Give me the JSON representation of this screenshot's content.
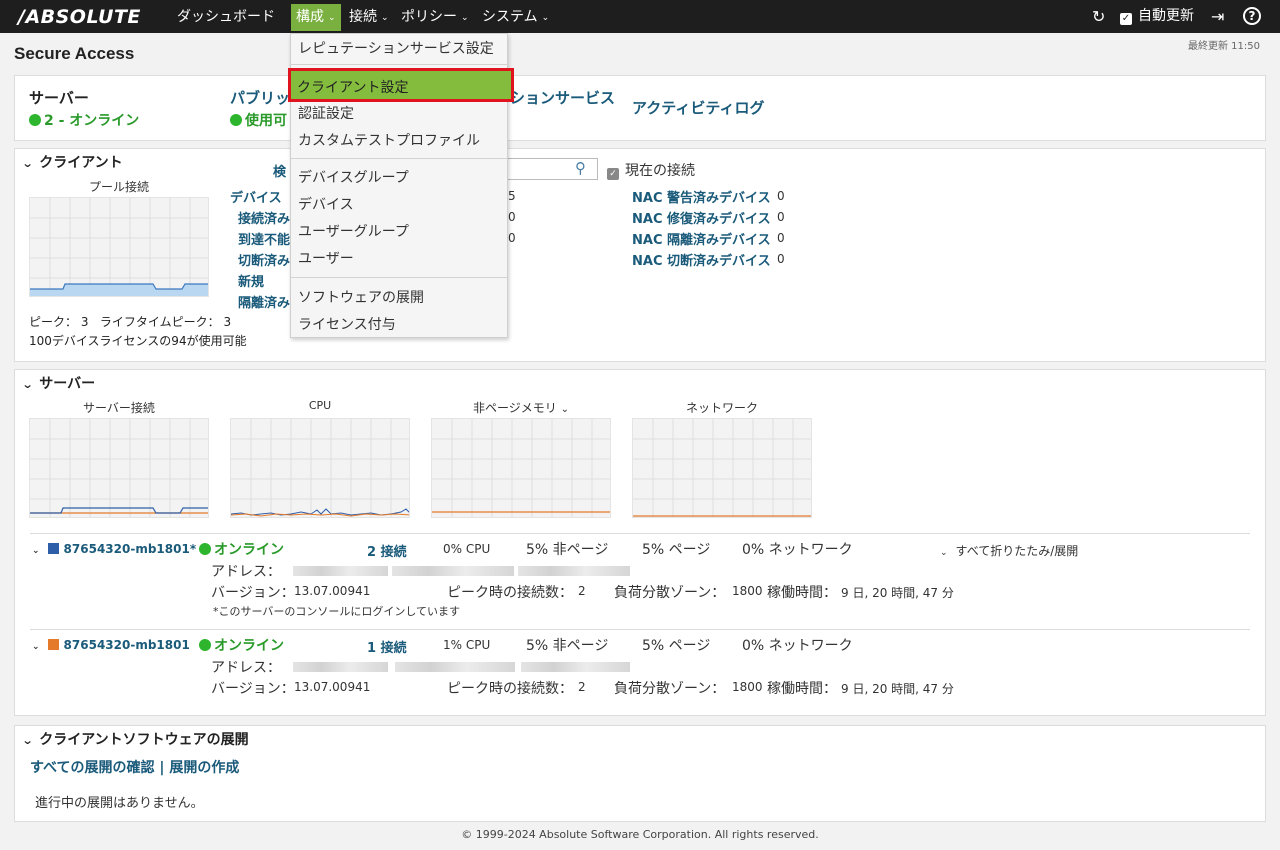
{
  "topbar": {
    "logo": "/ABSOLUTE",
    "nav": {
      "dashboard": "ダッシュボード",
      "config": "構成",
      "connect": "接続",
      "policy": "ポリシー",
      "system": "システム"
    },
    "auto_update_label": "自動更新",
    "auto_update_checked": true
  },
  "page": {
    "title": "Secure Access",
    "last_updated": "最終更新 11:50"
  },
  "summary": {
    "server_label": "サーバー",
    "server_status": "2 - オンライン",
    "public_label": "パブリック",
    "public_status": "使用可",
    "reputation_label": "ションサービス",
    "activity_log": "アクティビティログ"
  },
  "clients": {
    "section_title": "クライアント",
    "pool_title": "プール接続",
    "search_label": "検",
    "current_conn_label": "現在の接続",
    "devices_link": "デバイス",
    "device_links": [
      "接続済み",
      "到達不能",
      "切断済み",
      "新規",
      "隔離済み"
    ],
    "device_values": [
      "5",
      "0",
      "0"
    ],
    "nac": [
      {
        "label": "NAC 警告済みデバイス",
        "value": "0"
      },
      {
        "label": "NAC 修復済みデバイス",
        "value": "0"
      },
      {
        "label": "NAC 隔離済みデバイス",
        "value": "0"
      },
      {
        "label": "NAC 切断済みデバイス",
        "value": "0"
      }
    ],
    "peak_text": "ピーク： 3   ライフタイムピーク： 3",
    "license_text": "100デバイスライセンスの94が使用可能"
  },
  "servers": {
    "section_title": "サーバー",
    "chart_titles": [
      "サーバー接続",
      "CPU",
      "非ページメモリ",
      "ネットワーク"
    ],
    "collapse_all": "すべて折りたたみ/展開",
    "labels": {
      "address": "アドレス：",
      "version": "バージョン：",
      "peak": "ピーク時の接続数：",
      "zone": "負荷分散ゾーン：",
      "uptime": "稼働時間："
    },
    "rows": [
      {
        "name": "87654320-mb1801*",
        "color": "#2f5ea8",
        "status": "オンライン",
        "connections": "2 接続",
        "cpu": "0% CPU",
        "nonpage": "5% 非ページ",
        "page": "5% ページ",
        "network": "0% ネットワーク",
        "version": "13.07.00941",
        "peak": "2",
        "zone": "1800",
        "uptime": "9 日, 20 時間, 47 分",
        "note": "*このサーバーのコンソールにログインしています"
      },
      {
        "name": "87654320-mb1801",
        "color": "#e57a2a",
        "status": "オンライン",
        "connections": "1 接続",
        "cpu": "1% CPU",
        "nonpage": "5% 非ページ",
        "page": "5% ページ",
        "network": "0% ネットワーク",
        "version": "13.07.00941",
        "peak": "2",
        "zone": "1800",
        "uptime": "9 日, 20 時間, 47 分",
        "note": ""
      }
    ]
  },
  "deploy": {
    "section_title": "クライアントソフトウェアの展開",
    "view_all": "すべての展開の確認",
    "create": "展開の作成",
    "empty": "進行中の展開はありません。"
  },
  "dropdown": {
    "items": [
      "レピュテーションサービス設定",
      "クライアント設定",
      "認証設定",
      "カスタムテストプロファイル",
      "デバイスグループ",
      "デバイス",
      "ユーザーグループ",
      "ユーザー",
      "ソフトウェアの展開",
      "ライセンス付与"
    ],
    "selected_index": 1
  },
  "footer": "© 1999-2024 Absolute Software Corporation. All rights reserved."
}
